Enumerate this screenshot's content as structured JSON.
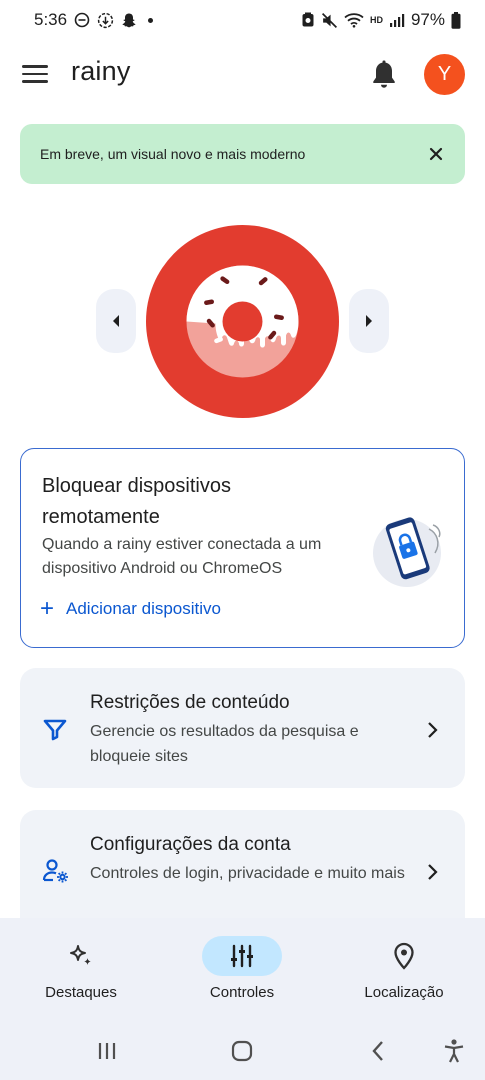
{
  "status_bar": {
    "time": "5:36",
    "battery": "97%",
    "left_icons": [
      "do-not-disturb-icon",
      "download-icon",
      "snapchat-icon"
    ],
    "right_icons": [
      "alarm-icon",
      "mute-icon",
      "wifi-icon",
      "hd-icon",
      "signal-icon",
      "battery-icon"
    ],
    "hd_label": "HD"
  },
  "app_bar": {
    "title": "rainy",
    "avatar_letter": "Y",
    "menu_icon": "menu-icon",
    "notification_icon": "bell-icon"
  },
  "banner": {
    "text": "Em breve, um visual novo e mais moderno",
    "close_icon": "close-icon"
  },
  "carousel": {
    "illustration": "donut-illustration",
    "prev_icon": "chevron-left-icon",
    "next_icon": "chevron-right-icon"
  },
  "lock_card": {
    "title": "Bloquear dispositivos remotamente",
    "description": "Quando a rainy estiver conectada a um dispositivo Android ou ChromeOS",
    "action_label": "Adicionar dispositivo",
    "action_icon": "plus-icon",
    "illustration": "locked-phone-illustration"
  },
  "settings": [
    {
      "title": "Restrições de conteúdo",
      "description": "Gerencie os resultados da pesquisa e bloqueie sites",
      "icon": "filter-icon"
    },
    {
      "title": "Configurações da conta",
      "description": "Controles de login, privacidade e muito mais",
      "icon": "manage-account-icon"
    }
  ],
  "bottom_nav": {
    "items": [
      {
        "label": "Destaques",
        "icon": "sparkle-icon",
        "active": false
      },
      {
        "label": "Controles",
        "icon": "tune-icon",
        "active": true
      },
      {
        "label": "Localização",
        "icon": "location-pin-icon",
        "active": false
      }
    ]
  },
  "system_nav": {
    "buttons": [
      "recents-icon",
      "home-icon",
      "back-icon",
      "accessibility-icon"
    ]
  },
  "colors": {
    "accent_blue": "#0b57d0",
    "banner_green": "#c4eed0",
    "avatar_orange": "#f4511e",
    "donut_red": "#e23c2f",
    "active_pill": "#c2e7ff",
    "card_bg": "#f0f3f8"
  }
}
